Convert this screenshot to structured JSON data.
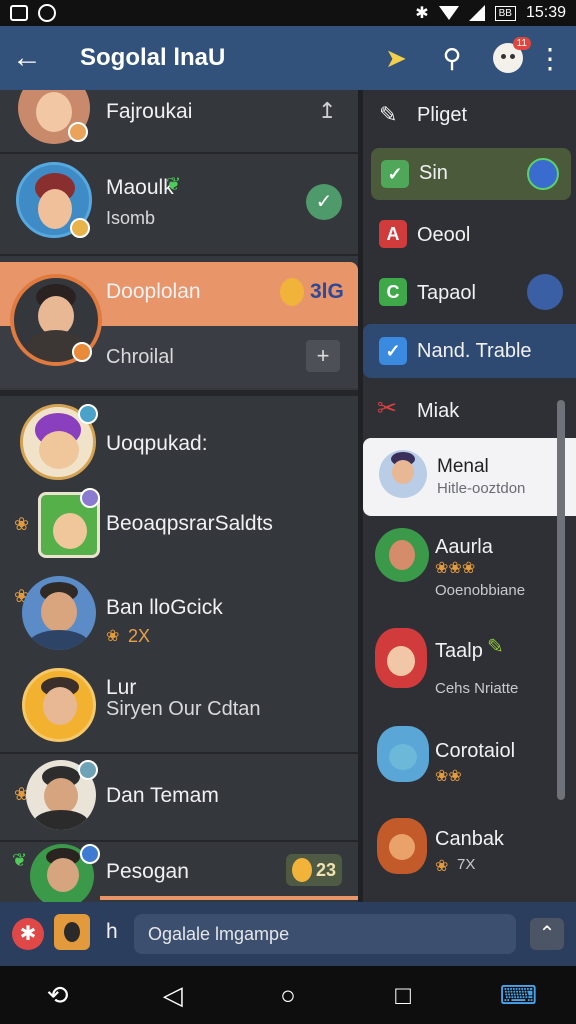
{
  "status": {
    "time": "15:39",
    "battery": "BB"
  },
  "appbar": {
    "title": "Sogolal lnaU"
  },
  "notifications": {
    "count": "11"
  },
  "left_list": [
    {
      "name": "Fajroukai"
    },
    {
      "name": "Maoulk",
      "sub": "Isomb"
    },
    {
      "name": "Dooplolan",
      "sub": "Chroilal",
      "pill": "3lG"
    },
    {
      "name": "Uoqpukad:"
    },
    {
      "name": "BeoaqpsrarSaldts"
    },
    {
      "name": "Ban lloGcick",
      "sub": "2X"
    },
    {
      "name": "Lur",
      "sub": "Siryen Our Cdtan"
    },
    {
      "name": "Dan Temam"
    },
    {
      "name": "Pesogan",
      "pill": "23"
    }
  ],
  "right_list": [
    {
      "label": "Pliget"
    },
    {
      "label": "Sin"
    },
    {
      "label": "Oeool"
    },
    {
      "label": "Tapaol"
    },
    {
      "label": "Nand. Trable"
    },
    {
      "label": "Miak"
    },
    {
      "label": "Menal",
      "sub": "Hitle-ooztdon"
    },
    {
      "label": "Aaurla",
      "sub": "Ooenobbiane"
    },
    {
      "label": "Taalp",
      "sub": "Cehs Nriatte"
    },
    {
      "label": "Corotaiol"
    },
    {
      "label": "Canbak",
      "sub": "7X"
    }
  ],
  "input": {
    "prefix": "h",
    "placeholder": "Ogalale lmgampe"
  },
  "colors": {
    "appbar": "#32527c",
    "highlight": "#e8956a",
    "selected": "#2f4a72",
    "green_row": "#4a5a3a"
  }
}
